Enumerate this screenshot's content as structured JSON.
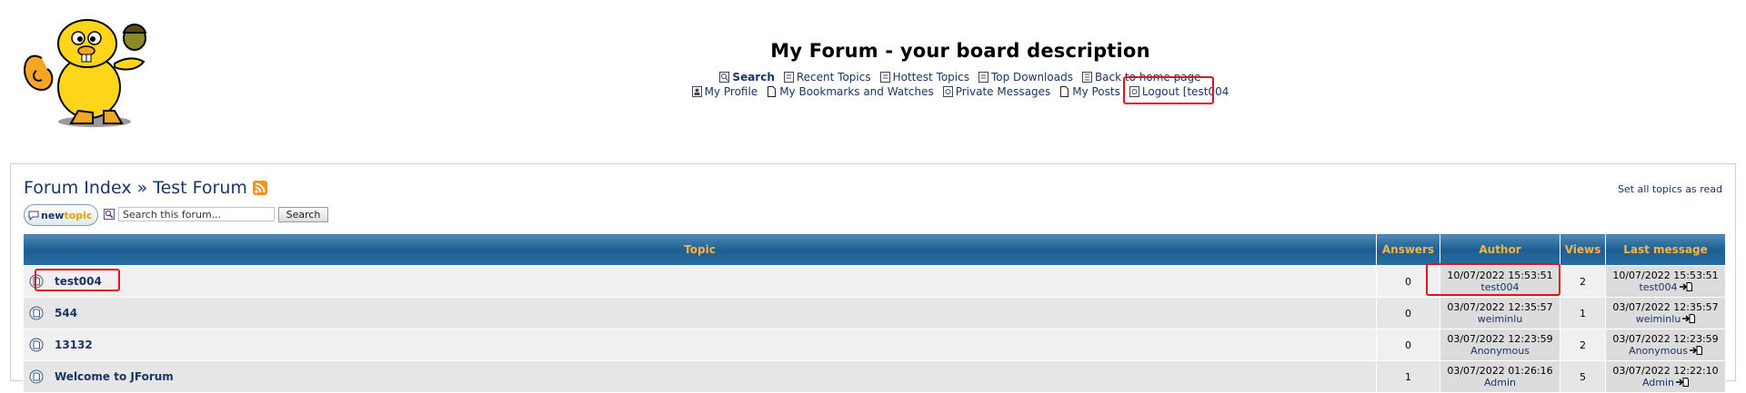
{
  "site": {
    "title": "My Forum - your board description"
  },
  "nav": {
    "row1": [
      {
        "label": "Search",
        "icon": "search-icon",
        "bold": true
      },
      {
        "label": "Recent Topics",
        "icon": "recent-topics-icon"
      },
      {
        "label": "Hottest Topics",
        "icon": "hottest-topics-icon"
      },
      {
        "label": "Top Downloads",
        "icon": "top-downloads-icon"
      },
      {
        "label": "Back to home page",
        "icon": "home-page-icon"
      }
    ],
    "row2": [
      {
        "label": "My Profile",
        "icon": "profile-icon"
      },
      {
        "label": "My Bookmarks and Watches",
        "icon": "bookmarks-icon"
      },
      {
        "label": "Private Messages",
        "icon": "private-messages-icon"
      },
      {
        "label": "My Posts",
        "icon": "my-posts-icon"
      },
      {
        "label": "Logout [test004",
        "icon": "logout-icon"
      }
    ]
  },
  "breadcrumb": {
    "root": "Forum Index",
    "separator": "»",
    "current": "Test Forum"
  },
  "actions": {
    "set_all_read": "Set all topics as read",
    "new_topic_word1": "new",
    "new_topic_word2": "topic",
    "search_placeholder": "Search this forum...",
    "search_button": "Search"
  },
  "table": {
    "headers": {
      "topic": "Topic",
      "answers": "Answers",
      "author": "Author",
      "views": "Views",
      "last": "Last message"
    },
    "rows": [
      {
        "title": "test004",
        "answers": "0",
        "author_date": "10/07/2022 15:53:51",
        "author": "test004",
        "views": "2",
        "last_date": "10/07/2022 15:53:51",
        "last_user": "test004"
      },
      {
        "title": "544",
        "answers": "0",
        "author_date": "03/07/2022 12:35:57",
        "author": "weiminlu",
        "views": "1",
        "last_date": "03/07/2022 12:35:57",
        "last_user": "weiminlu"
      },
      {
        "title": "13132",
        "answers": "0",
        "author_date": "03/07/2022 12:23:59",
        "author": "Anonymous",
        "views": "2",
        "last_date": "03/07/2022 12:23:59",
        "last_user": "Anonymous"
      },
      {
        "title": "Welcome to JForum",
        "answers": "1",
        "author_date": "03/07/2022 01:26:16",
        "author": "Admin",
        "views": "5",
        "last_date": "03/07/2022 12:22:10",
        "last_user": "Admin"
      }
    ]
  },
  "colors": {
    "link": "#1c3466",
    "header_text": "#ffb53f",
    "header_bg": "#1d5f93",
    "highlight": "#e0141e"
  }
}
